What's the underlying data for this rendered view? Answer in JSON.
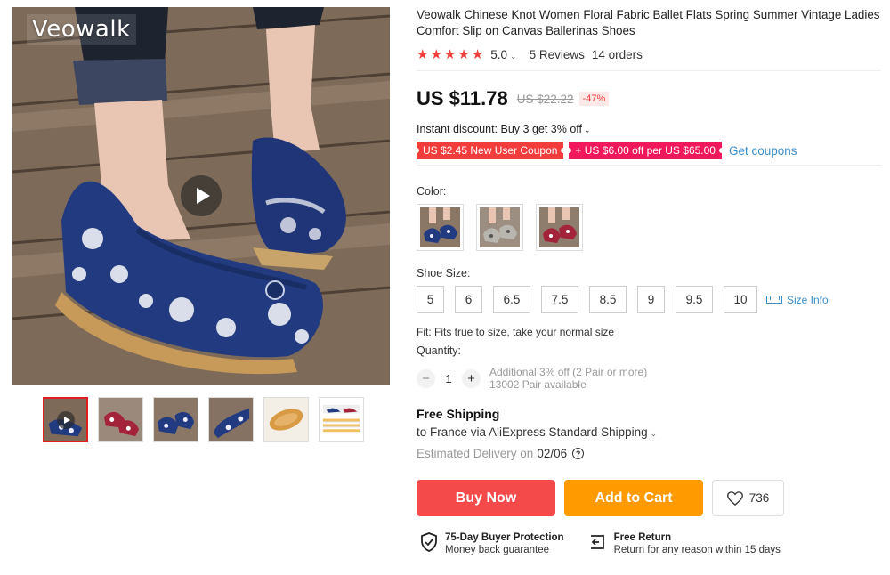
{
  "gallery": {
    "watermark": "Veowalk",
    "thumbnails": [
      "video",
      "red-pair",
      "blue-pair",
      "blue-side",
      "sole",
      "size-chart"
    ]
  },
  "product": {
    "title": "Veowalk Chinese Knot Women Floral Fabric Ballet Flats Spring Summer Vintage Ladies Comfort Slip on Canvas Ballerinas Shoes",
    "rating": "5.0",
    "reviews": "5 Reviews",
    "orders": "14 orders",
    "stars": 5
  },
  "price": {
    "current": "US $11.78",
    "original": "US $22.22",
    "discount": "-47%"
  },
  "promo": {
    "instant": "Instant discount: Buy 3 get 3% off",
    "coupon1": "US $2.45 New User Coupon",
    "coupon2": "+ US $6.00 off per US $65.00",
    "get_coupons": "Get coupons"
  },
  "options": {
    "color_label": "Color:",
    "colors": [
      "blue",
      "grey",
      "red"
    ],
    "size_label": "Shoe Size:",
    "sizes": [
      "5",
      "6",
      "6.5",
      "7.5",
      "8.5",
      "9",
      "9.5",
      "10"
    ],
    "size_info": "Size Info",
    "fit": "Fit: Fits true to size, take your normal size"
  },
  "quantity": {
    "label": "Quantity:",
    "minus": "−",
    "plus": "+",
    "value": "1",
    "note1": "Additional 3% off (2 Pair or more)",
    "note2": "13002 Pair available"
  },
  "shipping": {
    "title": "Free Shipping",
    "to": "to France via AliExpress Standard Shipping",
    "delivery_prefix": "Estimated Delivery on",
    "delivery_date": "02/06"
  },
  "actions": {
    "buy_now": "Buy Now",
    "add_to_cart": "Add to Cart",
    "wishlist_count": "736"
  },
  "guarantees": {
    "protection_title": "75-Day Buyer Protection",
    "protection_sub": "Money back guarantee",
    "return_title": "Free Return",
    "return_sub": "Return for any reason within 15 days"
  },
  "colors": {
    "price_red": "#f33d3d",
    "buy_now": "#f44a4a",
    "add_to_cart": "#ff9a00",
    "link_blue": "#3b8fc9"
  }
}
